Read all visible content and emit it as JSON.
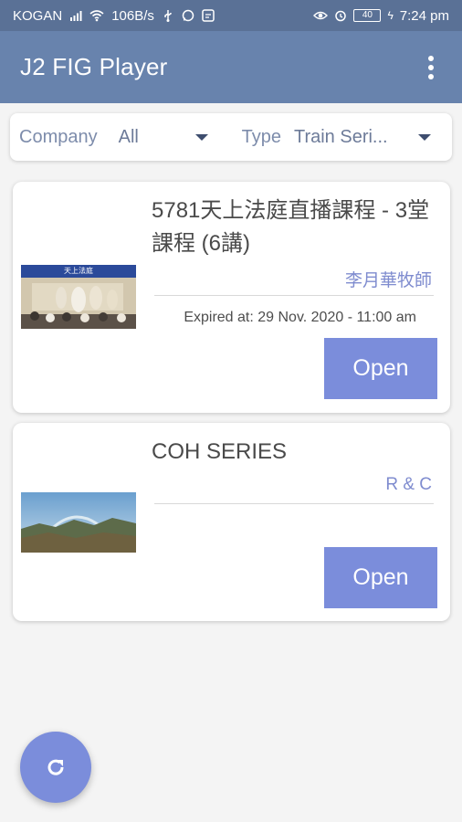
{
  "status_bar": {
    "carrier": "KOGAN",
    "network_speed": "106B/s",
    "battery_level": "40",
    "time": "7:24 pm"
  },
  "app_bar": {
    "title": "J2 FIG Player",
    "menu_icon": "more-vert-icon"
  },
  "filter": {
    "company_label": "Company",
    "company_value": "All",
    "type_label": "Type",
    "type_value": "Train Seri..."
  },
  "courses": [
    {
      "title": "5781天上法庭直播課程 - 3堂課程 (6講)",
      "author": "李月華牧師",
      "expiry": "Expired at: 29 Nov. 2020 - 11:00 am",
      "thumbnail_caption": "天上法庭",
      "open_label": "Open"
    },
    {
      "title": "COH SERIES",
      "author": "R & C",
      "open_label": "Open"
    }
  ],
  "fab": {
    "icon": "refresh-icon"
  },
  "colors": {
    "primary": "#6883ad",
    "status": "#5a7196",
    "accent": "#7b8ddb"
  }
}
